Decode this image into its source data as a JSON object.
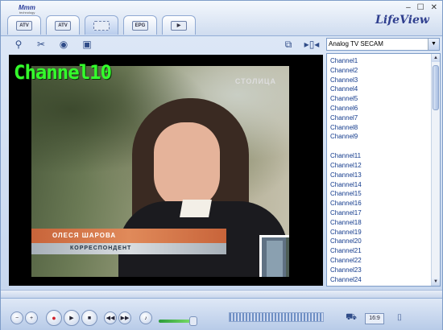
{
  "app": {
    "logo_text": "Mmm",
    "logo_sub": "technology",
    "brand": "LifeView",
    "window_buttons": [
      "–",
      "☐",
      "✕"
    ]
  },
  "tabs": [
    {
      "label": "ATV",
      "icon": "analog-tv-icon",
      "active": false
    },
    {
      "label": "ATV",
      "icon": "tv-antenna-icon",
      "active": false
    },
    {
      "label": "",
      "icon": "capture-icon",
      "active": true
    },
    {
      "label": "EPG",
      "icon": "epg-icon",
      "active": false
    },
    {
      "label": "▶",
      "icon": "playback-icon",
      "active": false
    }
  ],
  "toolbar": {
    "icons": [
      "scan-icon",
      "settings-icon",
      "record-icon",
      "schedule-icon"
    ],
    "right_icons": [
      "pip-icon",
      "layout-icon"
    ]
  },
  "source_select": {
    "value": "Analog TV SECAM"
  },
  "video": {
    "channel_overlay": "Channel10",
    "station_logo": "СТОЛИЦА",
    "lower_third_name": "ОЛЕСЯ ШАРОВА",
    "lower_third_role": "КОРРЕСПОНДЕНТ"
  },
  "channel_list": [
    "Channel1",
    "Channel2",
    "Channel3",
    "Channel4",
    "Channel5",
    "Channel6",
    "Channel7",
    "Channel8",
    "Channel9",
    "",
    "Channel11",
    "Channel12",
    "Channel13",
    "Channel14",
    "Channel15",
    "Channel16",
    "Channel17",
    "Channel18",
    "Channel19",
    "Channel20",
    "Channel21",
    "Channel22",
    "Channel23",
    "Channel24"
  ],
  "controls": {
    "aspect_ratio": "16:9",
    "volume_level": 0.62
  },
  "colors": {
    "overlay_green": "#34ff2c",
    "list_text": "#123a8c",
    "accent": "#2f3f8f"
  }
}
